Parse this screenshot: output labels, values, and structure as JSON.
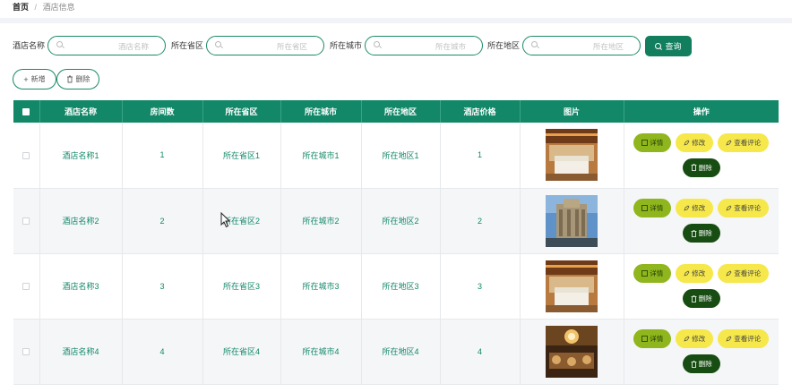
{
  "breadcrumb": {
    "home": "首页",
    "separator": "/",
    "current": "酒店信息"
  },
  "search": {
    "fields": [
      {
        "label": "酒店名称",
        "placeholder": "酒店名称"
      },
      {
        "label": "所在省区",
        "placeholder": "所在省区"
      },
      {
        "label": "所在城市",
        "placeholder": "所在城市"
      },
      {
        "label": "所在地区",
        "placeholder": "所在地区"
      }
    ],
    "query_label": "查询"
  },
  "actions": {
    "add_label": "新增",
    "delete_label": "删除"
  },
  "table": {
    "headers": [
      "酒店名称",
      "房间数",
      "所在省区",
      "所在城市",
      "所在地区",
      "酒店价格",
      "图片",
      "操作"
    ],
    "rows": [
      {
        "name": "酒店名称1",
        "rooms": "1",
        "province": "所在省区1",
        "city": "所在城市1",
        "district": "所在地区1",
        "price": "1"
      },
      {
        "name": "酒店名称2",
        "rooms": "2",
        "province": "所在省区2",
        "city": "所在城市2",
        "district": "所在地区2",
        "price": "2"
      },
      {
        "name": "酒店名称3",
        "rooms": "3",
        "province": "所在省区3",
        "city": "所在城市3",
        "district": "所在地区3",
        "price": "3"
      },
      {
        "name": "酒店名称4",
        "rooms": "4",
        "province": "所在省区4",
        "city": "所在城市4",
        "district": "所在地区4",
        "price": "4"
      }
    ],
    "row_actions": {
      "detail": "详情",
      "edit": "修改",
      "review": "查看评论",
      "delete": "删除"
    }
  },
  "colors": {
    "primary": "#128868",
    "detail_button": "#8fb61c",
    "edit_button": "#f6e84a",
    "delete_button": "#174d12"
  },
  "icons": [
    "search-icon",
    "plus-icon",
    "trash-icon",
    "edit-icon",
    "checkbox-icon",
    "cursor-icon"
  ]
}
